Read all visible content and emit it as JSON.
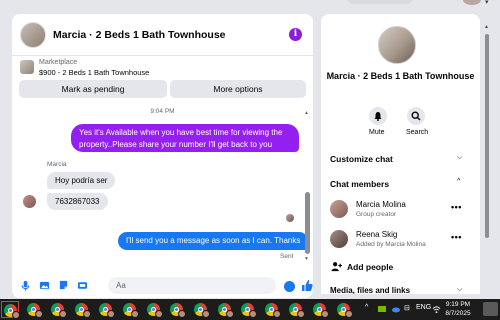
{
  "chat": {
    "title": "Marcia · 2 Beds 1 Bath Townhouse",
    "marketplace_label": "Marketplace",
    "listing": "$900 - 2 Beds 1 Bath Townhouse",
    "mark_pending": "Mark as pending",
    "more_options": "More options",
    "timestamp": "9:04 PM",
    "messages": [
      {
        "from": "me",
        "text": "Yes it's Available when you have best time for viewing the property..Please share your number I'll get back to you soon."
      },
      {
        "from": "Marcia",
        "text": "Hoy podría ser"
      },
      {
        "from": "Marcia",
        "text": "7632867033"
      },
      {
        "from": "me",
        "text": "I'll send you a message as soon as I can. Thanks"
      }
    ],
    "sender_name": "Marcia",
    "sent_status": "Sent",
    "composer_placeholder": "Aa"
  },
  "info": {
    "title": "Marcia · 2 Beds 1 Bath Townhouse",
    "mute": "Mute",
    "search": "Search",
    "customize_chat": "Customize chat",
    "chat_members": "Chat members",
    "members": [
      {
        "name": "Marcia Molina",
        "role": "Group creator"
      },
      {
        "name": "Reena Skig",
        "role": "Added by Marcia Molina"
      }
    ],
    "add_people": "Add people",
    "media_files_links": "Media, files and links"
  },
  "taskbar": {
    "language": "ENG",
    "time": "9:19 PM",
    "date": "8/7/2025"
  },
  "icons": [
    "info-icon",
    "bell-icon",
    "search-icon",
    "chevron-down-icon",
    "chevron-up-icon",
    "more-icon",
    "add-person-icon",
    "mic-icon",
    "image-icon",
    "sticker-icon",
    "gif-icon",
    "emoji-icon",
    "like-icon",
    "chrome-icon",
    "wifi-icon",
    "speaker-icon",
    "battery-icon"
  ]
}
